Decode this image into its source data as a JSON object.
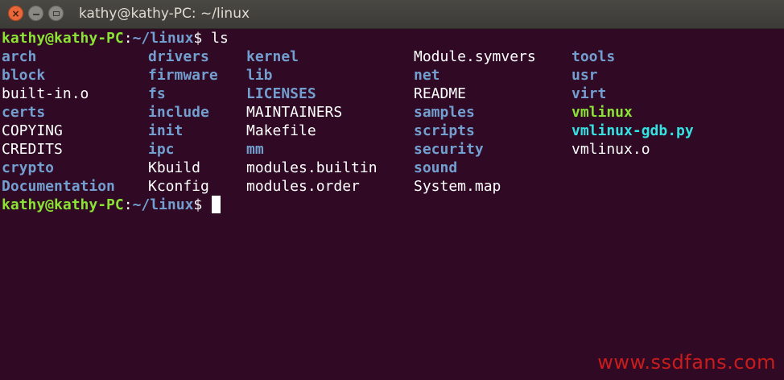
{
  "window": {
    "title": "kathy@kathy-PC: ~/linux",
    "buttons": {
      "close_glyph": "×",
      "min_glyph": "",
      "max_glyph": ""
    }
  },
  "terminal": {
    "prompt_userhost": "kathy@kathy-PC",
    "prompt_colon": ":",
    "prompt_path": "~/linux",
    "prompt_dollar": "$",
    "command": " ls",
    "listing": [
      [
        {
          "name": "arch",
          "type": "dir"
        },
        {
          "name": "drivers",
          "type": "dir"
        },
        {
          "name": "kernel",
          "type": "dir"
        },
        {
          "name": "Module.symvers",
          "type": "file"
        },
        {
          "name": "tools",
          "type": "dir"
        }
      ],
      [
        {
          "name": "block",
          "type": "dir"
        },
        {
          "name": "firmware",
          "type": "dir"
        },
        {
          "name": "lib",
          "type": "dir"
        },
        {
          "name": "net",
          "type": "dir"
        },
        {
          "name": "usr",
          "type": "dir"
        }
      ],
      [
        {
          "name": "built-in.o",
          "type": "file"
        },
        {
          "name": "fs",
          "type": "dir"
        },
        {
          "name": "LICENSES",
          "type": "dir"
        },
        {
          "name": "README",
          "type": "file"
        },
        {
          "name": "virt",
          "type": "dir"
        }
      ],
      [
        {
          "name": "certs",
          "type": "dir"
        },
        {
          "name": "include",
          "type": "dir"
        },
        {
          "name": "MAINTAINERS",
          "type": "file"
        },
        {
          "name": "samples",
          "type": "dir"
        },
        {
          "name": "vmlinux",
          "type": "exec"
        }
      ],
      [
        {
          "name": "COPYING",
          "type": "file"
        },
        {
          "name": "init",
          "type": "dir"
        },
        {
          "name": "Makefile",
          "type": "file"
        },
        {
          "name": "scripts",
          "type": "dir"
        },
        {
          "name": "vmlinux-gdb.py",
          "type": "link"
        }
      ],
      [
        {
          "name": "CREDITS",
          "type": "file"
        },
        {
          "name": "ipc",
          "type": "dir"
        },
        {
          "name": "mm",
          "type": "dir"
        },
        {
          "name": "security",
          "type": "dir"
        },
        {
          "name": "vmlinux.o",
          "type": "file"
        }
      ],
      [
        {
          "name": "crypto",
          "type": "dir"
        },
        {
          "name": "Kbuild",
          "type": "file"
        },
        {
          "name": "modules.builtin",
          "type": "file"
        },
        {
          "name": "sound",
          "type": "dir"
        },
        null
      ],
      [
        {
          "name": "Documentation",
          "type": "dir"
        },
        {
          "name": "Kconfig",
          "type": "file"
        },
        {
          "name": "modules.order",
          "type": "file"
        },
        {
          "name": "System.map",
          "type": "file"
        },
        null
      ]
    ]
  },
  "watermark": "www.ssdfans.com",
  "colors": {
    "background": "#300a24",
    "prompt": "#8ae234",
    "path": "#729fcf",
    "directory": "#729fcf",
    "executable": "#8ae234",
    "symlink": "#34e2e2",
    "file": "#ffffff",
    "watermark": "#c91c1c"
  }
}
